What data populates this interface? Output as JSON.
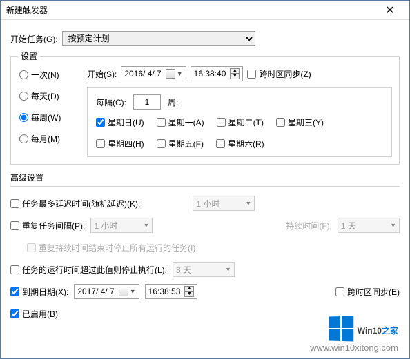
{
  "title": "新建触发器",
  "startTask": {
    "label": "开始任务(G):",
    "value": "按预定计划"
  },
  "settings": {
    "legend": "设置",
    "radios": {
      "once": "一次(N)",
      "daily": "每天(D)",
      "weekly": "每周(W)",
      "monthly": "每月(M)"
    },
    "start": {
      "label": "开始(S):",
      "date": "2016/ 4/ 7",
      "time": "16:38:40",
      "sync": "跨时区同步(Z)"
    },
    "interval": {
      "label": "每隔(C):",
      "value": "1",
      "unit": "周:"
    },
    "days": {
      "sun": "星期日(U)",
      "mon": "星期一(A)",
      "tue": "星期二(T)",
      "wed": "星期三(Y)",
      "thu": "星期四(H)",
      "fri": "星期五(F)",
      "sat": "星期六(R)"
    }
  },
  "advanced": {
    "legend": "高级设置",
    "delay": {
      "label": "任务最多延迟时间(随机延迟)(K):",
      "value": "1 小时"
    },
    "repeat": {
      "label": "重复任务间隔(P):",
      "value": "1 小时",
      "durationLabel": "持续时间(F):",
      "durationValue": "1 天"
    },
    "stopAtEnd": "重复持续时间结束时停止所有运行的任务(I)",
    "stopIfOver": {
      "label": "任务的运行时间超过此值则停止执行(L):",
      "value": "3 天"
    },
    "expire": {
      "label": "到期日期(X):",
      "date": "2017/ 4/ 7",
      "time": "16:38:53",
      "sync": "跨时区同步(E)"
    },
    "enabled": "已启用(B)"
  },
  "watermark": {
    "brand1": "Win10",
    "brand2": "之家",
    "url": "www.win10xitong.com"
  }
}
